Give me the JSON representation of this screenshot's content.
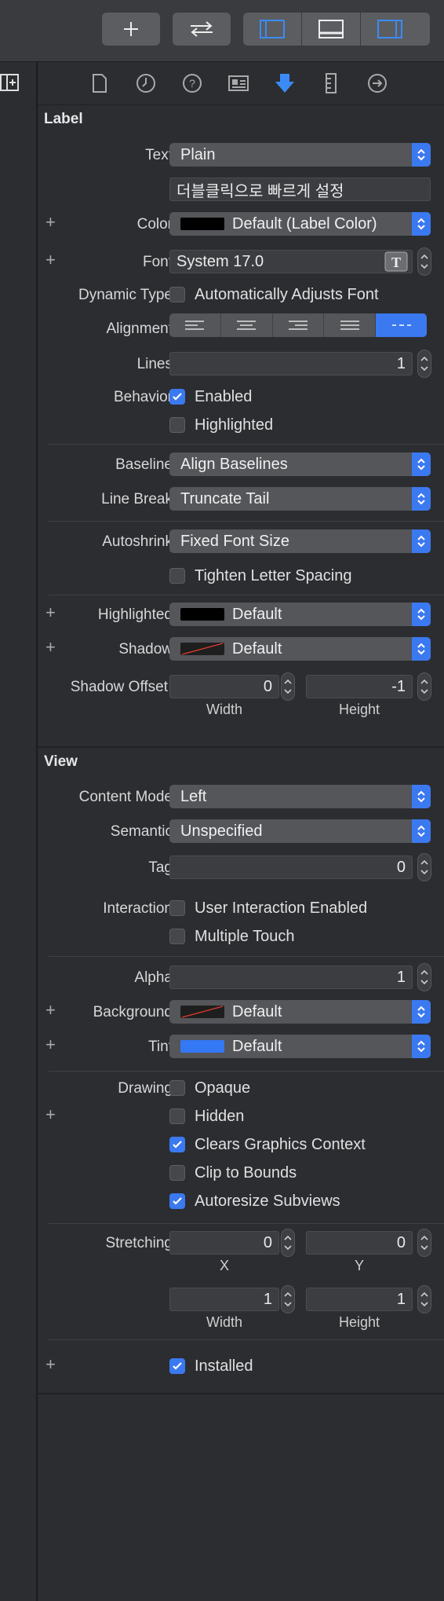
{
  "toolbar": {
    "add_icon": "plus-icon",
    "swap_icon": "swap-arrows-icon",
    "panel_icons": [
      "left-panel-icon",
      "bottom-panel-icon",
      "right-panel-icon"
    ]
  },
  "tabs": [
    "file-icon",
    "clock-icon",
    "help-icon",
    "identity-icon",
    "attributes-icon",
    "ruler-icon",
    "connections-icon"
  ],
  "label_section": {
    "title": "Label",
    "text_label": "Text",
    "text_value": "Plain",
    "text_content": "더블클릭으로 빠르게 설정",
    "color_label": "Color",
    "color_value": "Default (Label Color)",
    "font_label": "Font",
    "font_value": "System 17.0",
    "dynamic_type_label": "Dynamic Type",
    "dynamic_type_cb": "Automatically Adjusts Font",
    "alignment_label": "Alignment",
    "lines_label": "Lines",
    "lines_value": "1",
    "behavior_label": "Behavior",
    "enabled": "Enabled",
    "highlighted_cb": "Highlighted",
    "baseline_label": "Baseline",
    "baseline_value": "Align Baselines",
    "linebreak_label": "Line Break",
    "linebreak_value": "Truncate Tail",
    "autoshrink_label": "Autoshrink",
    "autoshrink_value": "Fixed Font Size",
    "tighten": "Tighten Letter Spacing",
    "highlighted_label": "Highlighted",
    "highlighted_value": "Default",
    "shadow_label": "Shadow",
    "shadow_value": "Default",
    "shadow_offset_label": "Shadow Offset",
    "shadow_w": "0",
    "shadow_h": "-1",
    "width_lbl": "Width",
    "height_lbl": "Height"
  },
  "view_section": {
    "title": "View",
    "content_mode_label": "Content Mode",
    "content_mode_value": "Left",
    "semantic_label": "Semantic",
    "semantic_value": "Unspecified",
    "tag_label": "Tag",
    "tag_value": "0",
    "interaction_label": "Interaction",
    "user_interaction": "User Interaction Enabled",
    "multiple_touch": "Multiple Touch",
    "alpha_label": "Alpha",
    "alpha_value": "1",
    "background_label": "Background",
    "background_value": "Default",
    "tint_label": "Tint",
    "tint_value": "Default",
    "drawing_label": "Drawing",
    "opaque": "Opaque",
    "hidden": "Hidden",
    "clears": "Clears Graphics Context",
    "clip": "Clip to Bounds",
    "autoresize": "Autoresize Subviews",
    "stretching_label": "Stretching",
    "sx": "0",
    "sy": "0",
    "sw": "1",
    "sh": "1",
    "x_lbl": "X",
    "y_lbl": "Y",
    "w_lbl": "Width",
    "h_lbl": "Height",
    "installed": "Installed"
  },
  "colors": {
    "accent": "#3b79f0",
    "tint_swatch": "#3478f6",
    "black_swatch": "#000000"
  }
}
